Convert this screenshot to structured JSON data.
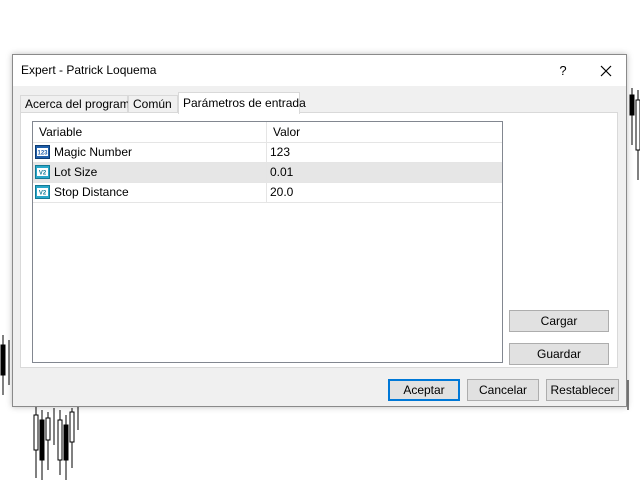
{
  "window": {
    "title": "Expert - Patrick Loquema",
    "help_label": "?"
  },
  "tabs": [
    {
      "label": "Acerca del programa"
    },
    {
      "label": "Común"
    },
    {
      "label": "Parámetros de entrada",
      "active": true
    }
  ],
  "table": {
    "headers": {
      "variable": "Variable",
      "value": "Valor"
    },
    "rows": [
      {
        "icon": "int-icon",
        "variable": "Magic Number",
        "value": "123"
      },
      {
        "icon": "double-icon",
        "variable": "Lot Size",
        "value": "0.01",
        "selected": true
      },
      {
        "icon": "double-icon",
        "variable": "Stop Distance",
        "value": "20.0"
      }
    ]
  },
  "buttons": {
    "load": "Cargar",
    "save": "Guardar",
    "ok": "Aceptar",
    "cancel": "Cancelar",
    "reset": "Restablecer"
  },
  "colors": {
    "accent": "#0078d7",
    "selection": "#e6e6e6"
  }
}
